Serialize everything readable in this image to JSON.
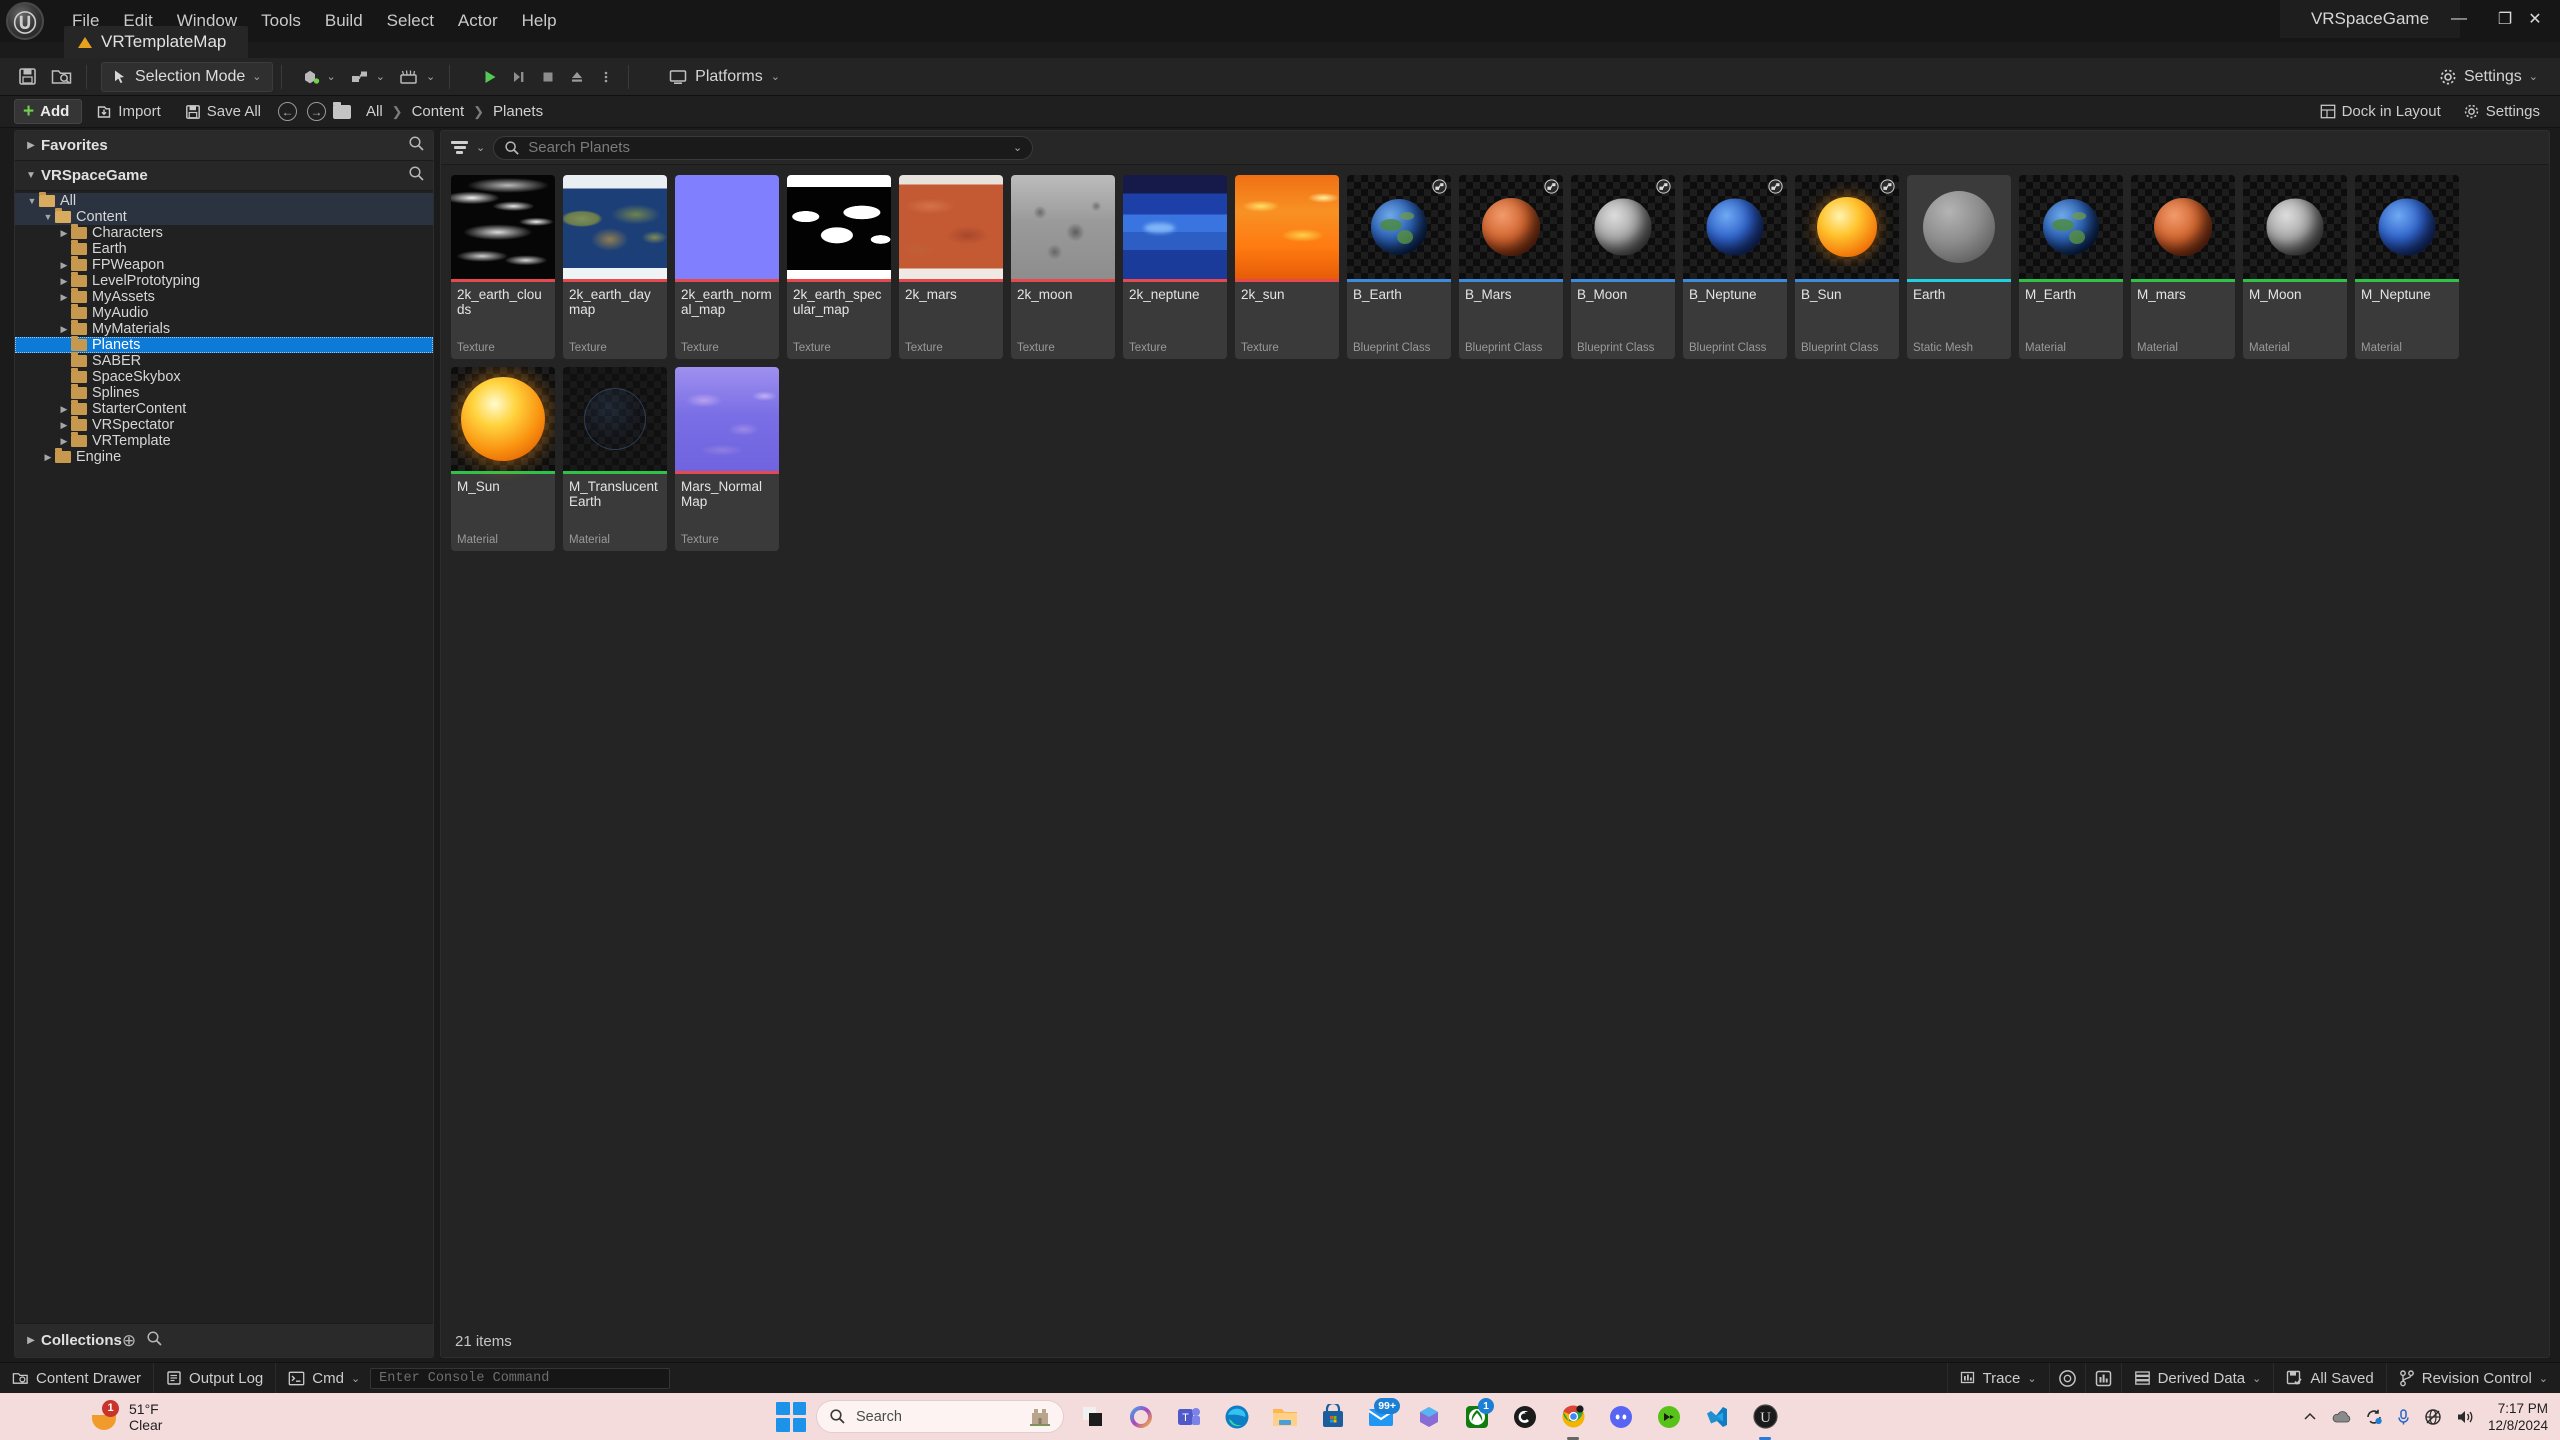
{
  "titlebar": {
    "logo": "unreal-engine-logo",
    "menus": [
      "File",
      "Edit",
      "Window",
      "Tools",
      "Build",
      "Select",
      "Actor",
      "Help"
    ],
    "map_tab": "VRTemplateMap",
    "window_title": "VRSpaceGame",
    "minimize": "—",
    "maximize": "❐",
    "close": "✕"
  },
  "toolbar": {
    "save_icon": "save-icon",
    "browse_icon": "browse-content-icon",
    "selection_mode": "Selection Mode",
    "chevron": "⌄",
    "create_icon": "create-actor-icon",
    "blueprints_icon": "blueprints-icon",
    "cinematics_icon": "cinematics-icon",
    "play_icon": "▶",
    "skip_icon": "▶❘",
    "stop_icon": "■",
    "eject_icon": "⏏",
    "more_icon": "⋮",
    "platforms": "Platforms",
    "settings": "Settings"
  },
  "content_browser": {
    "add_label": "Add",
    "import_label": "Import",
    "save_all_label": "Save All",
    "back_icon": "←",
    "forward_icon": "→",
    "breadcrumbs": [
      "All",
      "Content",
      "Planets"
    ],
    "breadcrumb_sep": "❯",
    "dock_in_layout": "Dock in Layout",
    "settings": "Settings"
  },
  "sidebar": {
    "favorites_label": "Favorites",
    "project_label": "VRSpaceGame",
    "collections_label": "Collections",
    "search_icon": "search-icon",
    "add_collection_icon": "⊕",
    "tree": [
      {
        "label": "All",
        "depth": 0,
        "arrow": "down",
        "state": "parent"
      },
      {
        "label": "Content",
        "depth": 1,
        "arrow": "down",
        "state": "parent"
      },
      {
        "label": "Characters",
        "depth": 2,
        "arrow": "right",
        "state": "normal"
      },
      {
        "label": "Earth",
        "depth": 2,
        "arrow": "none",
        "state": "normal"
      },
      {
        "label": "FPWeapon",
        "depth": 2,
        "arrow": "right",
        "state": "normal"
      },
      {
        "label": "LevelPrototyping",
        "depth": 2,
        "arrow": "right",
        "state": "normal"
      },
      {
        "label": "MyAssets",
        "depth": 2,
        "arrow": "right",
        "state": "normal"
      },
      {
        "label": "MyAudio",
        "depth": 2,
        "arrow": "none",
        "state": "normal"
      },
      {
        "label": "MyMaterials",
        "depth": 2,
        "arrow": "right",
        "state": "normal"
      },
      {
        "label": "Planets",
        "depth": 2,
        "arrow": "none",
        "state": "selected"
      },
      {
        "label": "SABER",
        "depth": 2,
        "arrow": "none",
        "state": "normal"
      },
      {
        "label": "SpaceSkybox",
        "depth": 2,
        "arrow": "none",
        "state": "normal"
      },
      {
        "label": "Splines",
        "depth": 2,
        "arrow": "none",
        "state": "normal"
      },
      {
        "label": "StarterContent",
        "depth": 2,
        "arrow": "right",
        "state": "normal"
      },
      {
        "label": "VRSpectator",
        "depth": 2,
        "arrow": "right",
        "state": "normal"
      },
      {
        "label": "VRTemplate",
        "depth": 2,
        "arrow": "right",
        "state": "normal"
      },
      {
        "label": "Engine",
        "depth": 1,
        "arrow": "right",
        "state": "normal"
      }
    ]
  },
  "asset_view": {
    "filter_icon": "filter-icon",
    "filter_chevron": "⌄",
    "search_placeholder": "Search Planets",
    "search_value": "",
    "item_count": "21 items",
    "type_colors": {
      "Texture": "#e5484d",
      "Blueprint Class": "#3d8bdd",
      "Static Mesh": "#1fd0e0",
      "Material": "#2fc24a"
    },
    "assets": [
      {
        "name": "2k_earth_clouds",
        "type": "Texture",
        "thumb": "earth-clouds"
      },
      {
        "name": "2k_earth_daymap",
        "type": "Texture",
        "thumb": "earth-daymap"
      },
      {
        "name": "2k_earth_normal_map",
        "type": "Texture",
        "thumb": "normal-map-flat"
      },
      {
        "name": "2k_earth_specular_map",
        "type": "Texture",
        "thumb": "earth-specular"
      },
      {
        "name": "2k_mars",
        "type": "Texture",
        "thumb": "mars-map"
      },
      {
        "name": "2k_moon",
        "type": "Texture",
        "thumb": "moon-map"
      },
      {
        "name": "2k_neptune",
        "type": "Texture",
        "thumb": "neptune-map"
      },
      {
        "name": "2k_sun",
        "type": "Texture",
        "thumb": "sun-map"
      },
      {
        "name": "B_Earth",
        "type": "Blueprint Class",
        "thumb": "sphere-earth",
        "badge": "blueprint-badge"
      },
      {
        "name": "B_Mars",
        "type": "Blueprint Class",
        "thumb": "sphere-mars",
        "badge": "blueprint-badge"
      },
      {
        "name": "B_Moon",
        "type": "Blueprint Class",
        "thumb": "sphere-moon",
        "badge": "blueprint-badge"
      },
      {
        "name": "B_Neptune",
        "type": "Blueprint Class",
        "thumb": "sphere-neptune",
        "badge": "blueprint-badge"
      },
      {
        "name": "B_Sun",
        "type": "Blueprint Class",
        "thumb": "sphere-sun",
        "badge": "blueprint-badge"
      },
      {
        "name": "Earth",
        "type": "Static Mesh",
        "thumb": "sphere-gray"
      },
      {
        "name": "M_Earth",
        "type": "Material",
        "thumb": "sphere-earth"
      },
      {
        "name": "M_mars",
        "type": "Material",
        "thumb": "sphere-mars"
      },
      {
        "name": "M_Moon",
        "type": "Material",
        "thumb": "sphere-moon"
      },
      {
        "name": "M_Neptune",
        "type": "Material",
        "thumb": "sphere-neptune"
      },
      {
        "name": "M_Sun",
        "type": "Material",
        "thumb": "sphere-sun-big"
      },
      {
        "name": "M_Translucent Earth",
        "type": "Material",
        "thumb": "translucent"
      },
      {
        "name": "Mars_NormalMap",
        "type": "Texture",
        "thumb": "mars-normal"
      }
    ]
  },
  "status_bar": {
    "content_drawer": "Content Drawer",
    "output_log": "Output Log",
    "cmd_label": "Cmd",
    "cmd_placeholder": "Enter Console Command",
    "cmd_value": "",
    "trace": "Trace",
    "derived_data": "Derived Data",
    "all_saved": "All Saved",
    "revision_control": "Revision Control"
  },
  "taskbar": {
    "weather_temp": "51°F",
    "weather_cond": "Clear",
    "weather_badge": "1",
    "search_placeholder": "Search",
    "start_icon": "windows-start-icon",
    "apps": [
      {
        "name": "file-explorer-dark-icon"
      },
      {
        "name": "copilot-icon"
      },
      {
        "name": "teams-icon"
      },
      {
        "name": "edge-icon"
      },
      {
        "name": "explorer-folder-icon"
      },
      {
        "name": "microsoft-store-icon"
      },
      {
        "name": "mail-icon",
        "badge": "99+"
      },
      {
        "name": "office-icon"
      },
      {
        "name": "xbox-icon",
        "badge": "1"
      },
      {
        "name": "game-bar-icon"
      },
      {
        "name": "chrome-icon",
        "running": true
      },
      {
        "name": "discord-icon"
      },
      {
        "name": "nvidia-icon"
      },
      {
        "name": "vscode-icon"
      },
      {
        "name": "unreal-engine-icon",
        "running": true
      }
    ],
    "tray": {
      "overflow": "⌃",
      "cloud": "onedrive-icon",
      "update": "windows-update-icon",
      "mic": "microphone-icon",
      "network": "network-icon",
      "volume": "volume-icon"
    },
    "time": "7:17 PM",
    "date": "12/8/2024"
  }
}
